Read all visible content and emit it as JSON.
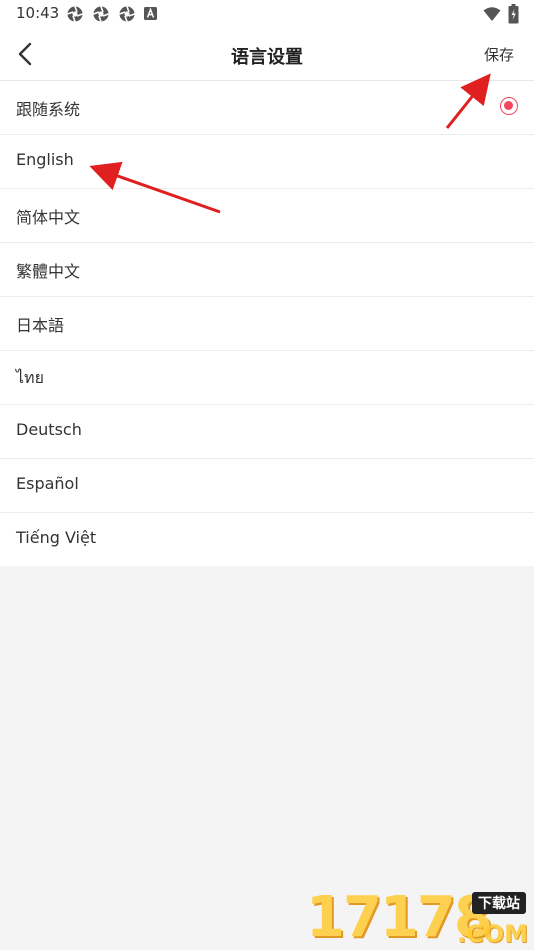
{
  "status_bar": {
    "time": "10:43",
    "icons_left": [
      "aperture-icon",
      "aperture-icon",
      "aperture-icon",
      "a-badge-icon"
    ],
    "icons_right": [
      "wifi-icon",
      "battery-icon"
    ]
  },
  "app_bar": {
    "back_icon": "chevron-left-icon",
    "title": "语言设置",
    "save_label": "保存"
  },
  "languages": [
    {
      "label": "跟随系统",
      "selected": true
    },
    {
      "label": "English",
      "selected": false
    },
    {
      "label": "简体中文",
      "selected": false
    },
    {
      "label": "繁體中文",
      "selected": false
    },
    {
      "label": "日本語",
      "selected": false
    },
    {
      "label": "ไทย",
      "selected": false
    },
    {
      "label": "Deutsch",
      "selected": false
    },
    {
      "label": "Español",
      "selected": false
    },
    {
      "label": "Tiếng Việt",
      "selected": false
    }
  ],
  "accent_color": "#f2485f",
  "annotation_color": "#e02020",
  "watermark": {
    "digits": "17178",
    "tag": "下载站",
    "suffix": ".COM"
  }
}
